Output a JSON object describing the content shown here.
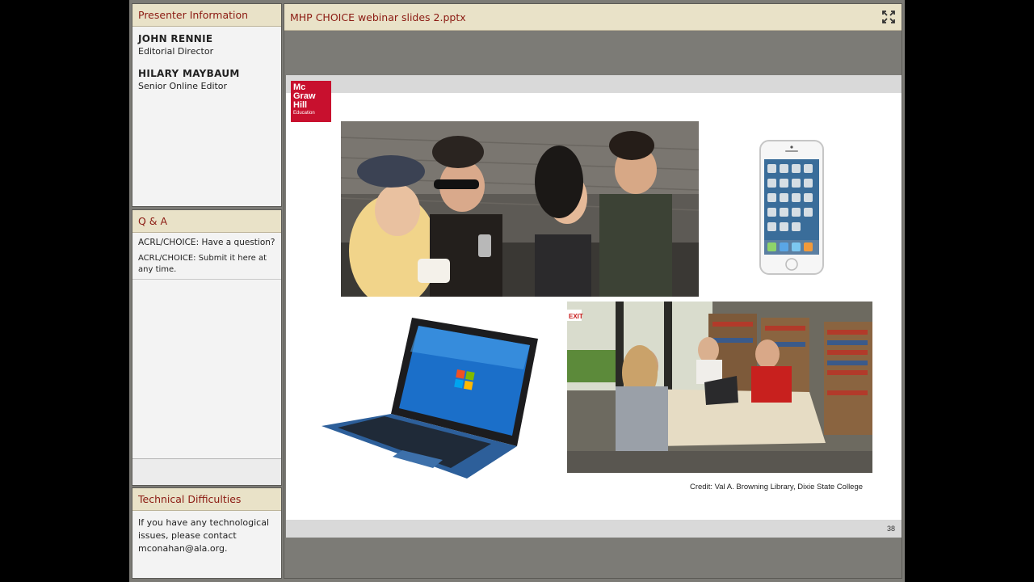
{
  "presenter_pod": {
    "title": "Presenter Information",
    "presenters": [
      {
        "name": "JOHN RENNIE",
        "title": "Editorial Director"
      },
      {
        "name": "HILARY MAYBAUM",
        "title": "Senior Online Editor"
      }
    ]
  },
  "qa_pod": {
    "title": "Q & A",
    "question": "ACRL/CHOICE: Have a question?",
    "answer": "ACRL/CHOICE: Submit it here at any time."
  },
  "tech_pod": {
    "title": "Technical Difficulties",
    "text": "If you have any technological issues, please contact mconahan@ala.org."
  },
  "share_pod": {
    "title": "MHP CHOICE webinar slides 2.pptx"
  },
  "slide": {
    "logo": [
      "Mc",
      "Graw",
      "Hill",
      "Education"
    ],
    "credit": "Credit: Val A. Browning Library, Dixie State College",
    "page_number": "38",
    "exit_sign": "EXIT"
  },
  "colors": {
    "pod_header_bg": "#e9e2c8",
    "pod_title": "#8b1a12",
    "app_bg": "#7c7b76",
    "logo_red": "#c8102e"
  }
}
